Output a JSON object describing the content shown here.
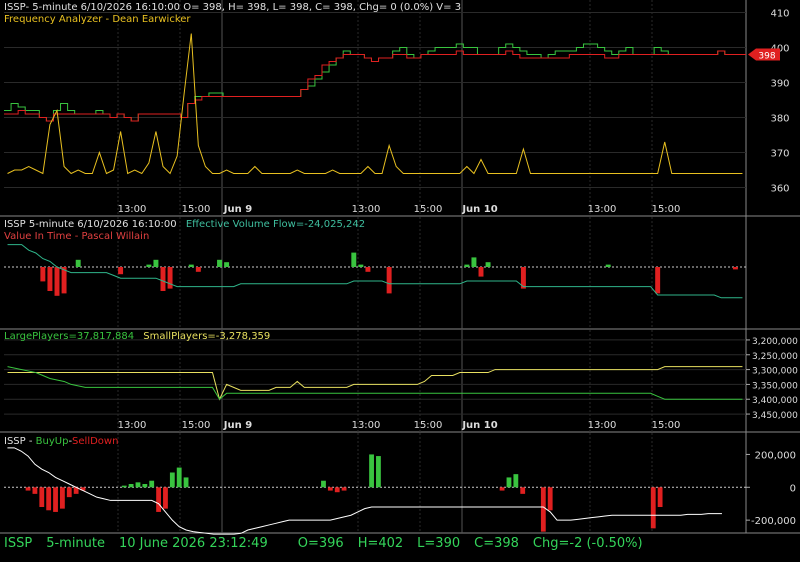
{
  "chart_data": [
    {
      "type": "line",
      "panel": "price",
      "title": "ISSP- 5-minute 6/10/2026 16:10:00 O= 398, H= 398, L= 398, C= 398, Chg= 0 (0.0%) V= 3",
      "subtitle": "Frequency Analyzer - Dean Earwicker",
      "ylim": [
        355,
        413
      ],
      "y_ticks": [
        360,
        370,
        380,
        390,
        400,
        410
      ],
      "price_tag": "398",
      "series": [
        {
          "values": [
            382,
            384,
            383,
            382,
            382,
            380,
            379,
            382,
            384,
            382,
            381,
            381,
            381,
            382,
            381,
            380,
            381,
            380,
            379,
            381,
            381,
            381,
            381,
            381,
            381,
            380,
            384,
            386,
            386,
            387,
            387,
            386,
            386,
            386,
            386,
            386,
            386,
            386,
            386,
            386,
            386,
            386,
            388,
            389,
            391,
            393,
            395,
            397,
            399,
            398,
            398,
            397,
            396,
            397,
            397,
            399,
            400,
            398,
            397,
            398,
            399,
            400,
            400,
            400,
            401,
            400,
            400,
            398,
            398,
            398,
            400,
            401,
            400,
            399,
            398,
            398,
            397,
            398,
            399,
            399,
            399,
            400,
            401,
            401,
            400,
            399,
            398,
            399,
            400,
            398,
            398,
            398,
            400,
            399,
            398,
            398,
            398,
            398,
            398,
            398,
            398,
            399,
            398,
            398,
            398
          ],
          "color": "#39c43f"
        },
        {
          "values": [
            381,
            381,
            382,
            381,
            381,
            380,
            379,
            381,
            381,
            381,
            381,
            381,
            381,
            381,
            381,
            380,
            381,
            380,
            379,
            381,
            381,
            381,
            381,
            381,
            381,
            380,
            384,
            385,
            386,
            386,
            386,
            386,
            386,
            386,
            386,
            386,
            386,
            386,
            386,
            386,
            386,
            386,
            388,
            391,
            392,
            395,
            396,
            397,
            398,
            398,
            398,
            397,
            396,
            397,
            397,
            398,
            398,
            397,
            397,
            398,
            398,
            398,
            398,
            398,
            399,
            398,
            398,
            398,
            398,
            398,
            398,
            399,
            398,
            397,
            397,
            397,
            397,
            397,
            397,
            397,
            398,
            398,
            398,
            398,
            398,
            397,
            397,
            398,
            398,
            398,
            398,
            398,
            398,
            398,
            398,
            398,
            398,
            398,
            398,
            398,
            398,
            399,
            398,
            398,
            398
          ],
          "color": "#e02020"
        },
        {
          "values": [
            364,
            365,
            365,
            366,
            365,
            364,
            378,
            382,
            366,
            364,
            365,
            364,
            364,
            370,
            364,
            365,
            376,
            364,
            365,
            364,
            367,
            376,
            366,
            364,
            369,
            387,
            404,
            372,
            366,
            364,
            364,
            365,
            364,
            364,
            364,
            366,
            364,
            364,
            364,
            364,
            364,
            365,
            364,
            364,
            364,
            364,
            365,
            364,
            364,
            364,
            364,
            366,
            364,
            364,
            372,
            366,
            364,
            364,
            364,
            364,
            364,
            364,
            364,
            364,
            364,
            366,
            364,
            368,
            364,
            364,
            364,
            364,
            364,
            371,
            364,
            364,
            364,
            364,
            364,
            364,
            364,
            364,
            364,
            364,
            364,
            364,
            364,
            364,
            364,
            364,
            364,
            364,
            364,
            373,
            364,
            364,
            364,
            364,
            364,
            364,
            364,
            364,
            364,
            364,
            364
          ],
          "color": "#e8c020"
        }
      ]
    },
    {
      "type": "bar",
      "panel": "volume-flow",
      "title": "ISSP 5-minute  6/10/2026 16:10:00",
      "subtitle": "Effective Volume Flow=-24,025,242",
      "subtitle2": "Value In Time - Pascal Willain",
      "values": [
        0,
        0,
        0,
        0,
        0,
        -6,
        -10,
        -12,
        -11,
        0,
        3,
        0,
        0,
        0,
        0,
        0,
        -3,
        0,
        0,
        0,
        1,
        3,
        -10,
        -9,
        0,
        0,
        1,
        -2,
        0,
        0,
        3,
        2,
        0,
        0,
        0,
        0,
        0,
        0,
        0,
        0,
        0,
        0,
        0,
        0,
        0,
        0,
        0,
        0,
        0,
        6,
        1,
        -2,
        0,
        0,
        -11,
        0,
        0,
        0,
        0,
        0,
        0,
        0,
        0,
        0,
        0,
        1,
        4,
        -4,
        2,
        0,
        0,
        0,
        0,
        -9,
        0,
        0,
        0,
        0,
        0,
        0,
        0,
        0,
        0,
        0,
        0,
        1,
        0,
        0,
        0,
        0,
        0,
        0,
        -11,
        0,
        0,
        0,
        0,
        0,
        0,
        0,
        0,
        0,
        0,
        -1,
        0
      ],
      "cumulative": [
        8,
        8,
        8,
        6,
        5,
        3,
        2,
        0,
        -1,
        -2,
        -2,
        -2,
        -2,
        -2,
        -2,
        -3,
        -4,
        -4,
        -4,
        -4,
        -4,
        -4,
        -5,
        -6,
        -7,
        -7,
        -7,
        -7,
        -7,
        -7,
        -7,
        -7,
        -7,
        -6,
        -6,
        -6,
        -6,
        -6,
        -6,
        -6,
        -6,
        -6,
        -6,
        -6,
        -6,
        -6,
        -6,
        -6,
        -6,
        -5,
        -5,
        -5,
        -5,
        -5,
        -6,
        -6,
        -6,
        -6,
        -6,
        -6,
        -6,
        -6,
        -6,
        -6,
        -6,
        -5,
        -5,
        -5,
        -5,
        -5,
        -5,
        -5,
        -5,
        -7,
        -7,
        -7,
        -7,
        -7,
        -7,
        -7,
        -7,
        -7,
        -7,
        -7,
        -7,
        -7,
        -7,
        -7,
        -7,
        -7,
        -7,
        -7,
        -10,
        -10,
        -10,
        -10,
        -10,
        -10,
        -10,
        -10,
        -10,
        -11,
        -11,
        -11,
        -11
      ],
      "cumulative_color": "#2fb58a"
    },
    {
      "type": "line",
      "panel": "players",
      "large_label": "LargePlayers=37,817,884",
      "small_label": "SmallPlayers=-3,278,359",
      "ylim": [
        3470000,
        3180000
      ],
      "y_ticks": [
        "3,200,000",
        "3,250,000",
        "3,300,000",
        "3,350,000",
        "3,400,000",
        "3,450,000"
      ],
      "series": [
        {
          "values": [
            3310000,
            3310000,
            3310000,
            3310000,
            3310000,
            3310000,
            3310000,
            3310000,
            3310000,
            3310000,
            3310000,
            3310000,
            3310000,
            3310000,
            3310000,
            3310000,
            3310000,
            3310000,
            3310000,
            3310000,
            3310000,
            3310000,
            3310000,
            3310000,
            3310000,
            3310000,
            3310000,
            3310000,
            3310000,
            3310000,
            3400000,
            3350000,
            3360000,
            3370000,
            3370000,
            3370000,
            3370000,
            3370000,
            3360000,
            3360000,
            3360000,
            3340000,
            3360000,
            3360000,
            3360000,
            3360000,
            3360000,
            3360000,
            3360000,
            3350000,
            3350000,
            3350000,
            3350000,
            3350000,
            3350000,
            3350000,
            3350000,
            3350000,
            3350000,
            3340000,
            3320000,
            3320000,
            3320000,
            3320000,
            3310000,
            3310000,
            3310000,
            3310000,
            3310000,
            3300000,
            3300000,
            3300000,
            3300000,
            3300000,
            3300000,
            3300000,
            3300000,
            3300000,
            3300000,
            3300000,
            3300000,
            3300000,
            3300000,
            3300000,
            3300000,
            3300000,
            3300000,
            3300000,
            3300000,
            3300000,
            3300000,
            3300000,
            3300000,
            3290000,
            3290000,
            3290000,
            3290000,
            3290000,
            3290000,
            3290000,
            3290000,
            3290000,
            3290000,
            3290000,
            3290000
          ],
          "color": "#e8e060"
        },
        {
          "values": [
            3290000,
            3295000,
            3300000,
            3305000,
            3310000,
            3320000,
            3330000,
            3335000,
            3340000,
            3350000,
            3355000,
            3360000,
            3360000,
            3360000,
            3360000,
            3360000,
            3360000,
            3360000,
            3360000,
            3360000,
            3360000,
            3360000,
            3360000,
            3360000,
            3360000,
            3360000,
            3360000,
            3360000,
            3360000,
            3360000,
            3400000,
            3380000,
            3380000,
            3380000,
            3380000,
            3380000,
            3380000,
            3380000,
            3380000,
            3380000,
            3380000,
            3380000,
            3380000,
            3380000,
            3380000,
            3380000,
            3380000,
            3380000,
            3380000,
            3380000,
            3380000,
            3380000,
            3380000,
            3380000,
            3380000,
            3380000,
            3380000,
            3380000,
            3380000,
            3380000,
            3380000,
            3380000,
            3380000,
            3380000,
            3380000,
            3380000,
            3380000,
            3380000,
            3380000,
            3380000,
            3380000,
            3380000,
            3380000,
            3380000,
            3380000,
            3380000,
            3380000,
            3380000,
            3380000,
            3380000,
            3380000,
            3380000,
            3380000,
            3380000,
            3380000,
            3380000,
            3380000,
            3380000,
            3380000,
            3380000,
            3380000,
            3380000,
            3390000,
            3400000,
            3400000,
            3400000,
            3400000,
            3400000,
            3400000,
            3400000,
            3400000,
            3400000,
            3400000,
            3400000,
            3400000
          ],
          "color": "#39c43f"
        }
      ]
    },
    {
      "type": "bar",
      "panel": "buyup-selldown",
      "title_a": "ISSP - ",
      "title_b": "BuyUp",
      "title_c": "-",
      "title_d": "SellDown",
      "ylim": [
        -260000,
        300000
      ],
      "y_ticks": [
        200000,
        0,
        -200000
      ],
      "y_tick_labels": [
        "200,000",
        "0",
        "-200,000"
      ],
      "values": [
        0,
        0,
        0,
        -20000,
        -40000,
        -120000,
        -140000,
        -150000,
        -130000,
        -60000,
        -40000,
        -20000,
        0,
        0,
        0,
        0,
        0,
        10000,
        20000,
        30000,
        20000,
        40000,
        -150000,
        -130000,
        90000,
        120000,
        60000,
        0,
        0,
        0,
        0,
        0,
        0,
        0,
        0,
        0,
        0,
        0,
        0,
        0,
        0,
        0,
        0,
        0,
        0,
        0,
        40000,
        -20000,
        -30000,
        -20000,
        0,
        0,
        0,
        200000,
        190000,
        0,
        0,
        0,
        0,
        0,
        0,
        0,
        0,
        0,
        0,
        0,
        0,
        0,
        0,
        0,
        0,
        0,
        -20000,
        60000,
        80000,
        -40000,
        0,
        0,
        -270000,
        -140000,
        0,
        0,
        0,
        0,
        0,
        0,
        0,
        0,
        0,
        0,
        0,
        0,
        0,
        0,
        -250000,
        -120000,
        0,
        0,
        0,
        0,
        0,
        0,
        0,
        0,
        0,
        0,
        0,
        0
      ],
      "cumulative": [
        240000,
        240000,
        220000,
        190000,
        140000,
        110000,
        90000,
        60000,
        40000,
        20000,
        0,
        -20000,
        -40000,
        -60000,
        -70000,
        -80000,
        -80000,
        -80000,
        -80000,
        -80000,
        -80000,
        -80000,
        -100000,
        -150000,
        -200000,
        -240000,
        -260000,
        -270000,
        -275000,
        -280000,
        -285000,
        -285000,
        -285000,
        -285000,
        -280000,
        -260000,
        -250000,
        -240000,
        -230000,
        -220000,
        -210000,
        -200000,
        -200000,
        -200000,
        -200000,
        -200000,
        -200000,
        -200000,
        -190000,
        -180000,
        -170000,
        -150000,
        -130000,
        -120000,
        -120000,
        -120000,
        -120000,
        -120000,
        -120000,
        -120000,
        -120000,
        -120000,
        -120000,
        -120000,
        -120000,
        -120000,
        -120000,
        -120000,
        -120000,
        -120000,
        -120000,
        -120000,
        -120000,
        -120000,
        -120000,
        -120000,
        -120000,
        -120000,
        -120000,
        -150000,
        -200000,
        -200000,
        -200000,
        -195000,
        -190000,
        -185000,
        -180000,
        -175000,
        -170000,
        -170000,
        -170000,
        -170000,
        -170000,
        -170000,
        -170000,
        -170000,
        -170000,
        -170000,
        -170000,
        -165000,
        -165000,
        -165000,
        -160000,
        -160000,
        -160000
      ],
      "cumulative_color": "#ffffff"
    }
  ],
  "x_axis": {
    "tick_labels": [
      "13:00",
      "15:00",
      "Jun 9",
      "13:00",
      "15:00",
      "Jun 10",
      "13:00",
      "15:00"
    ]
  },
  "status": {
    "symbol": "ISSP",
    "interval": "5-minute",
    "datetime": "10 June 2026 23:12:49",
    "open": "O=396",
    "high": "H=402",
    "low": "L=390",
    "close": "C=398",
    "change": "Chg=-2 (-0.50%)"
  },
  "colors": {
    "background": "#000000",
    "grid": "#2a2a2a",
    "up": "#39c43f",
    "down": "#e02020",
    "frequency": "#e8c020",
    "status_text": "#34d45a"
  }
}
